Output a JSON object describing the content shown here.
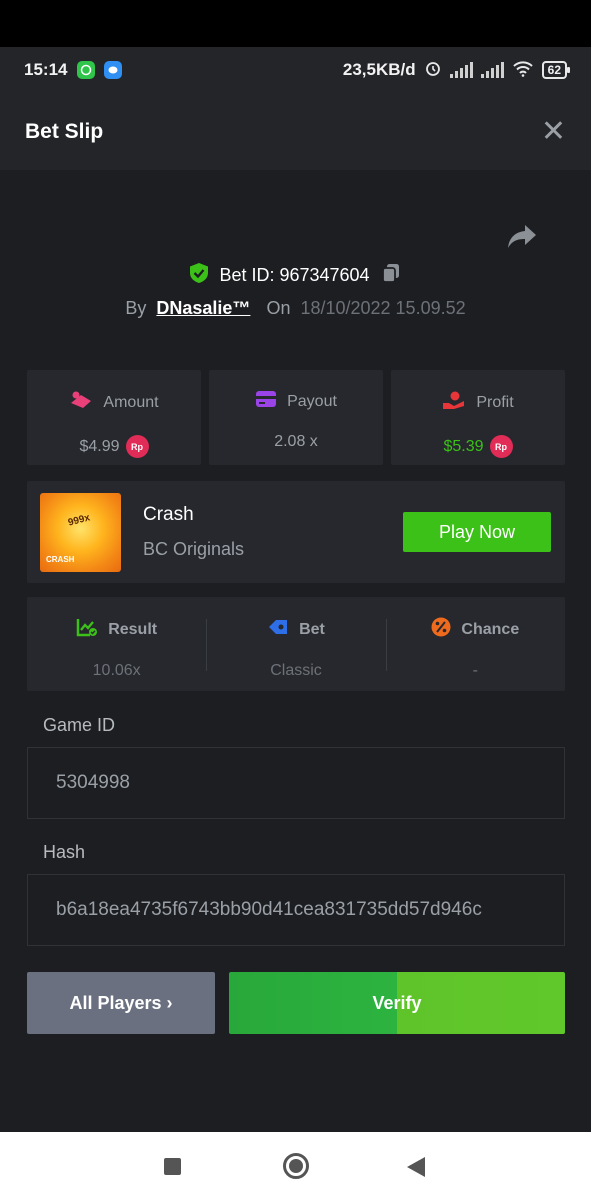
{
  "status_bar": {
    "time": "15:14",
    "net_speed": "23,5KB/d",
    "battery": "62"
  },
  "header": {
    "title": "Bet Slip",
    "close_symbol": "✕"
  },
  "bet": {
    "id_label": "Bet ID: 967347604",
    "by_label": "By",
    "user": "DNasalie™",
    "on_label": "On",
    "date": "18/10/2022 15.09.52"
  },
  "stats": {
    "amount": {
      "label": "Amount",
      "value": "$4.99",
      "currency": "Rp"
    },
    "payout": {
      "label": "Payout",
      "value": "2.08 x"
    },
    "profit": {
      "label": "Profit",
      "value": "$5.39",
      "currency": "Rp"
    }
  },
  "game": {
    "thumb_mult": "999x",
    "thumb_name": "CRASH",
    "name": "Crash",
    "provider": "BC Originals",
    "play_label": "Play Now"
  },
  "details": {
    "result": {
      "label": "Result",
      "value": "10.06x"
    },
    "bet": {
      "label": "Bet",
      "value": "Classic"
    },
    "chance": {
      "label": "Chance",
      "value": "-"
    }
  },
  "fields": {
    "game_id_label": "Game ID",
    "game_id_value": "5304998",
    "hash_label": "Hash",
    "hash_value": "b6a18ea4735f6743bb90d41cea831735dd57d946c"
  },
  "actions": {
    "players_label": "All Players ›",
    "verify_label": "Verify"
  },
  "colors": {
    "accent_green": "#3bc117",
    "currency_badge": "#e02c57",
    "background": "#1c1e22",
    "card": "#26282d"
  }
}
